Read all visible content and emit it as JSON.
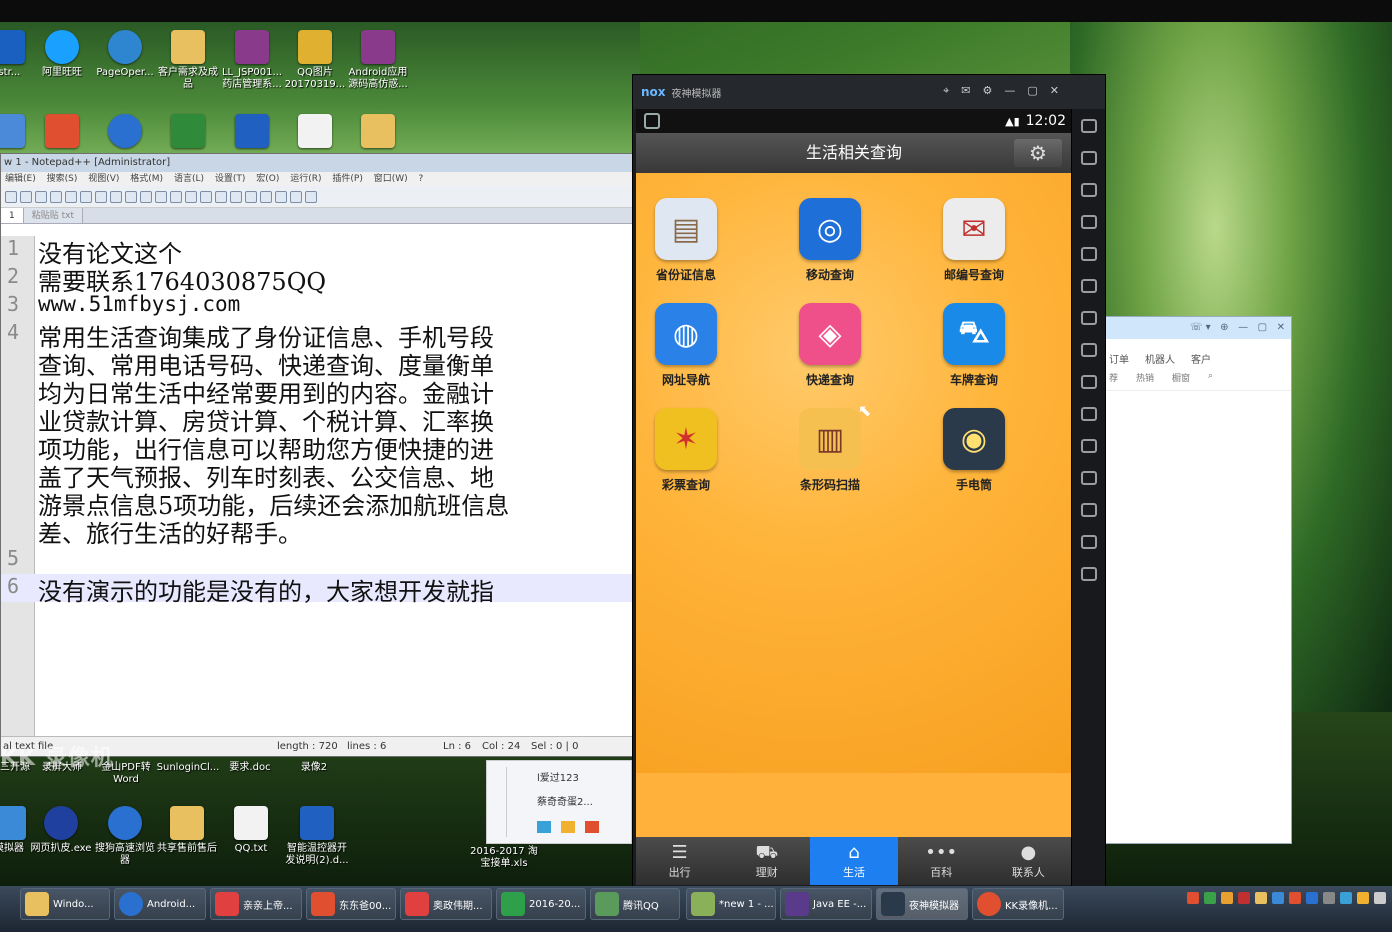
{
  "desktop": {
    "top_icons": [
      {
        "label": "istr...",
        "color": "#1a60c0"
      },
      {
        "label": "阿里旺旺",
        "color": "#1aa0ff"
      },
      {
        "label": "PageOper...",
        "color": "#2f86d0"
      },
      {
        "label": "客户需求及成品",
        "color": "#e8c060"
      },
      {
        "label": "LL_JSP001... 药店管理系...",
        "color": "#8a3a8a"
      },
      {
        "label": "QQ图片 20170319...",
        "color": "#e0b030"
      },
      {
        "label": "Android应用 源码高仿惑...",
        "color": "#8a3a8a"
      }
    ],
    "bottom_icons": [
      {
        "label": "三开源",
        "color": "#b03030"
      },
      {
        "label": "录屏大师",
        "color": "#e05050"
      },
      {
        "label": "金山PDF转 Word",
        "color": "#c03030"
      },
      {
        "label": "SunloginCl...",
        "color": "#e07a20"
      },
      {
        "label": "要求.doc",
        "color": "#2060c0"
      },
      {
        "label": "录像2",
        "color": "#999999"
      }
    ],
    "bottom_icons2": [
      {
        "label": "模拟器",
        "color": "#3a8ad8"
      },
      {
        "label": "网页扒皮.exe",
        "color": "#2040a0"
      },
      {
        "label": "搜狗高速浏览器",
        "color": "#2a70d0"
      },
      {
        "label": "共享售前售后",
        "color": "#e8c060"
      },
      {
        "label": "QQ.txt",
        "color": "#f2f2f2"
      },
      {
        "label": "智能温控器开 发说明(2).d...",
        "color": "#2060c0"
      },
      {
        "label": "2016-2017 淘宝接单.xls",
        "color": "#2f8a3a"
      }
    ],
    "watermark": "KK 录像机"
  },
  "notepad": {
    "title": "w 1 - Notepad++ [Administrator]",
    "menu": [
      "编辑(E)",
      "搜索(S)",
      "视图(V)",
      "格式(M)",
      "语言(L)",
      "设置(T)",
      "宏(O)",
      "运行(R)",
      "插件(P)",
      "窗口(W)",
      "?"
    ],
    "tabs": [
      "1",
      "粘贴贴 txt"
    ],
    "lines": [
      {
        "no": "1",
        "text": "没有论文这个"
      },
      {
        "no": "2",
        "text": "需要联系1764030875QQ"
      },
      {
        "no": "3",
        "text": "www.51mfbysj.com"
      },
      {
        "no": "4",
        "text": "常用生活查询集成了身份证信息、手机号段"
      },
      {
        "no": "",
        "text": "查询、常用电话号码、快递查询、度量衡单"
      },
      {
        "no": "",
        "text": "均为日常生活中经常要用到的内容。金融计"
      },
      {
        "no": "",
        "text": "业贷款计算、房贷计算、个税计算、汇率换"
      },
      {
        "no": "",
        "text": "项功能，出行信息可以帮助您方便快捷的进"
      },
      {
        "no": "",
        "text": "盖了天气预报、列车时刻表、公交信息、地"
      },
      {
        "no": "",
        "text": "游景点信息5项功能，后续还会添加航班信息"
      },
      {
        "no": "",
        "text": "差、旅行生活的好帮手。"
      },
      {
        "no": "5",
        "text": ""
      },
      {
        "no": "6",
        "text": "没有演示的功能是没有的，大家想开发就指"
      }
    ],
    "status": {
      "type": "al text file",
      "length": "length : 720",
      "lines": "lines : 6",
      "ln": "Ln : 6",
      "col": "Col : 24",
      "sel": "Sel : 0 | 0"
    }
  },
  "nox": {
    "title": "夜神模拟器",
    "logo": "nox",
    "clock": "12:02",
    "header": "生活相关查询",
    "apps": [
      {
        "label": "省份证信息",
        "icon": "id-card-icon",
        "bg": "#dfe8f2",
        "glyph": "▤"
      },
      {
        "label": "移动查询",
        "icon": "china-mobile-icon",
        "bg": "#1e6fd8",
        "glyph": "◎"
      },
      {
        "label": "邮编号查询",
        "icon": "envelope-icon",
        "bg": "#ececec",
        "glyph": "✉"
      },
      {
        "label": "网址导航",
        "icon": "globe-icon",
        "bg": "#2a82e8",
        "glyph": "🌐"
      },
      {
        "label": "快递查询",
        "icon": "package-icon",
        "bg": "#f0508a",
        "glyph": "◈"
      },
      {
        "label": "车牌查询",
        "icon": "car-icon",
        "bg": "#1a8ae8",
        "glyph": "🚗"
      },
      {
        "label": "彩票查询",
        "icon": "lottery-icon",
        "bg": "#f0c020",
        "glyph": "✶"
      },
      {
        "label": "条形码扫描",
        "icon": "barcode-icon",
        "bg": "#f5c050",
        "glyph": "▥"
      },
      {
        "label": "手电筒",
        "icon": "flashlight-icon",
        "bg": "#2a3a4a",
        "glyph": "◉"
      }
    ],
    "nav": [
      {
        "label": "出行",
        "glyph": "≡"
      },
      {
        "label": "理财",
        "glyph": "⛟"
      },
      {
        "label": "生活",
        "glyph": "⌂"
      },
      {
        "label": "百科",
        "glyph": "•••"
      },
      {
        "label": "联系人",
        "glyph": "●"
      }
    ]
  },
  "qq": {
    "tabs": [
      "订单",
      "机器人",
      "客户"
    ],
    "sub": [
      "荐",
      "热销",
      "橱窗"
    ],
    "contacts": [
      "l爱过123",
      "蔡奇奇蛋2..."
    ]
  },
  "taskbar": [
    {
      "label": "Windo...",
      "color": "#e8c060"
    },
    {
      "label": "Android...",
      "color": "#2a70d0"
    },
    {
      "label": "亲亲上帝...",
      "color": "#e04040"
    },
    {
      "label": "东东爸00...",
      "color": "#e05030"
    },
    {
      "label": "奥政伟期...",
      "color": "#e04040"
    },
    {
      "label": "2016-20...",
      "color": "#2fa04a"
    },
    {
      "label": "腾讯QQ",
      "color": "#5a9a5a"
    },
    {
      "label": "*new 1 - ...",
      "color": "#8ab05a"
    },
    {
      "label": "Java EE -...",
      "color": "#5a3a8a"
    },
    {
      "label": "夜神模拟器",
      "color": "#2a3a4a"
    },
    {
      "label": "KK录像机...",
      "color": "#e05030"
    }
  ]
}
